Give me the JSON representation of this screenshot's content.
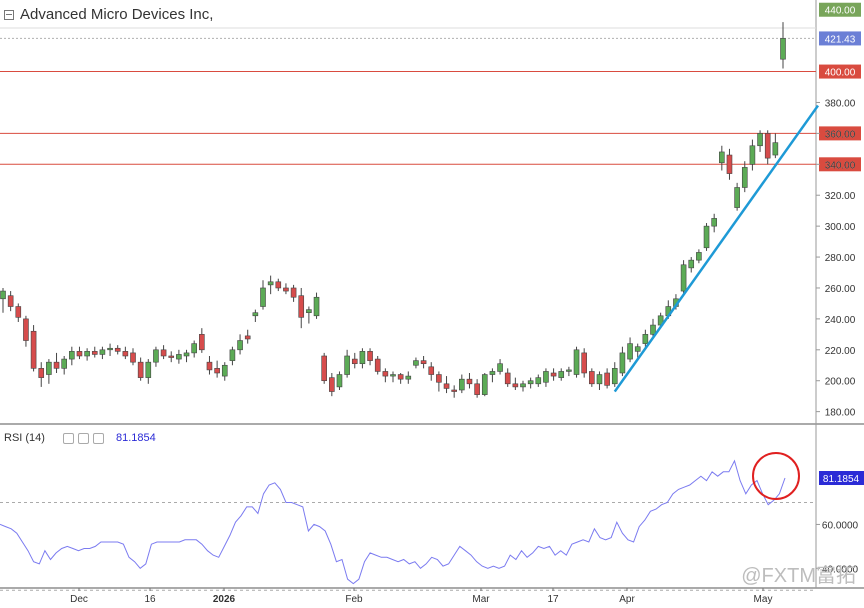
{
  "title": "Advanced Micro Devices Inc,",
  "watermark": "@FXTM富拓",
  "chart_data": [
    {
      "type": "candlestick",
      "title": "Advanced Micro Devices Inc,",
      "ylim": [
        172,
        445
      ],
      "y_ticks": [
        180,
        200,
        220,
        240,
        260,
        280,
        300,
        320,
        340,
        360,
        380
      ],
      "x_tick_labels": [
        "Dec",
        "16",
        "2026",
        "Feb",
        "Mar",
        "17",
        "Apr",
        "May"
      ],
      "up_color": "#5cab56",
      "down_color": "#d64c4c",
      "trendline_color": "#1e9ad6",
      "horizontal_lines": [
        {
          "value": 400,
          "label": "400.00",
          "color": "#d94b3f"
        },
        {
          "value": 360,
          "label": "360.00",
          "color": "#d94b3f"
        },
        {
          "value": 340,
          "label": "340.00",
          "color": "#d94b3f"
        }
      ],
      "price_labels": [
        {
          "value": 440,
          "label": "440.00",
          "color": "#78a55a"
        },
        {
          "value": 421.43,
          "label": "421.43",
          "color": "#6b7fd6"
        }
      ],
      "trendline": {
        "from": {
          "date": "Apr 1",
          "price": 193
        },
        "to": {
          "date": "May 6",
          "price": 378
        }
      },
      "candles": [
        {
          "o": 253,
          "h": 260,
          "l": 244,
          "c": 258
        },
        {
          "o": 255,
          "h": 258,
          "l": 245,
          "c": 248
        },
        {
          "o": 248,
          "h": 250,
          "l": 238,
          "c": 241
        },
        {
          "o": 240,
          "h": 242,
          "l": 222,
          "c": 226
        },
        {
          "o": 232,
          "h": 236,
          "l": 206,
          "c": 208
        },
        {
          "o": 208,
          "h": 212,
          "l": 196,
          "c": 202
        },
        {
          "o": 204,
          "h": 214,
          "l": 198,
          "c": 212
        },
        {
          "o": 212,
          "h": 218,
          "l": 205,
          "c": 208
        },
        {
          "o": 208,
          "h": 216,
          "l": 204,
          "c": 214
        },
        {
          "o": 214,
          "h": 222,
          "l": 210,
          "c": 219
        },
        {
          "o": 219,
          "h": 222,
          "l": 214,
          "c": 216
        },
        {
          "o": 216,
          "h": 221,
          "l": 213,
          "c": 219
        },
        {
          "o": 219,
          "h": 222,
          "l": 215,
          "c": 217
        },
        {
          "o": 217,
          "h": 222,
          "l": 214,
          "c": 220
        },
        {
          "o": 220,
          "h": 224,
          "l": 216,
          "c": 221
        },
        {
          "o": 221,
          "h": 223,
          "l": 217,
          "c": 219
        },
        {
          "o": 219,
          "h": 222,
          "l": 214,
          "c": 216
        },
        {
          "o": 218,
          "h": 221,
          "l": 210,
          "c": 212
        },
        {
          "o": 212,
          "h": 215,
          "l": 200,
          "c": 202
        },
        {
          "o": 202,
          "h": 214,
          "l": 198,
          "c": 212
        },
        {
          "o": 212,
          "h": 222,
          "l": 209,
          "c": 220
        },
        {
          "o": 220,
          "h": 223,
          "l": 214,
          "c": 216
        },
        {
          "o": 216,
          "h": 219,
          "l": 212,
          "c": 215
        },
        {
          "o": 214,
          "h": 220,
          "l": 211,
          "c": 217
        },
        {
          "o": 216,
          "h": 220,
          "l": 212,
          "c": 218
        },
        {
          "o": 218,
          "h": 226,
          "l": 215,
          "c": 224
        },
        {
          "o": 230,
          "h": 234,
          "l": 218,
          "c": 220
        },
        {
          "o": 212,
          "h": 216,
          "l": 204,
          "c": 207
        },
        {
          "o": 208,
          "h": 213,
          "l": 202,
          "c": 205
        },
        {
          "o": 203,
          "h": 212,
          "l": 200,
          "c": 210
        },
        {
          "o": 213,
          "h": 222,
          "l": 210,
          "c": 220
        },
        {
          "o": 220,
          "h": 230,
          "l": 217,
          "c": 226
        },
        {
          "o": 229,
          "h": 233,
          "l": 224,
          "c": 227
        },
        {
          "o": 242,
          "h": 246,
          "l": 238,
          "c": 244
        },
        {
          "o": 248,
          "h": 265,
          "l": 246,
          "c": 260
        },
        {
          "o": 262,
          "h": 268,
          "l": 256,
          "c": 264
        },
        {
          "o": 264,
          "h": 266,
          "l": 258,
          "c": 260
        },
        {
          "o": 260,
          "h": 263,
          "l": 256,
          "c": 258
        },
        {
          "o": 260,
          "h": 262,
          "l": 251,
          "c": 254
        },
        {
          "o": 255,
          "h": 260,
          "l": 234,
          "c": 241
        },
        {
          "o": 244,
          "h": 248,
          "l": 237,
          "c": 246
        },
        {
          "o": 242,
          "h": 257,
          "l": 240,
          "c": 254
        },
        {
          "o": 216,
          "h": 218,
          "l": 198,
          "c": 200
        },
        {
          "o": 202,
          "h": 205,
          "l": 190,
          "c": 193
        },
        {
          "o": 196,
          "h": 206,
          "l": 194,
          "c": 204
        },
        {
          "o": 204,
          "h": 220,
          "l": 202,
          "c": 216
        },
        {
          "o": 214,
          "h": 218,
          "l": 208,
          "c": 211
        },
        {
          "o": 211,
          "h": 221,
          "l": 208,
          "c": 219
        },
        {
          "o": 219,
          "h": 221,
          "l": 210,
          "c": 213
        },
        {
          "o": 214,
          "h": 216,
          "l": 204,
          "c": 206
        },
        {
          "o": 206,
          "h": 208,
          "l": 199,
          "c": 203
        },
        {
          "o": 203,
          "h": 206,
          "l": 199,
          "c": 204
        },
        {
          "o": 204,
          "h": 205,
          "l": 198,
          "c": 201
        },
        {
          "o": 201,
          "h": 206,
          "l": 198,
          "c": 203
        },
        {
          "o": 210,
          "h": 215,
          "l": 208,
          "c": 213
        },
        {
          "o": 213,
          "h": 216,
          "l": 208,
          "c": 211
        },
        {
          "o": 209,
          "h": 212,
          "l": 200,
          "c": 204
        },
        {
          "o": 204,
          "h": 206,
          "l": 193,
          "c": 199
        },
        {
          "o": 198,
          "h": 203,
          "l": 192,
          "c": 195
        },
        {
          "o": 194,
          "h": 197,
          "l": 189,
          "c": 193
        },
        {
          "o": 194,
          "h": 204,
          "l": 192,
          "c": 201
        },
        {
          "o": 201,
          "h": 205,
          "l": 195,
          "c": 198
        },
        {
          "o": 198,
          "h": 201,
          "l": 189,
          "c": 191
        },
        {
          "o": 191,
          "h": 205,
          "l": 190,
          "c": 204
        },
        {
          "o": 204,
          "h": 208,
          "l": 199,
          "c": 206
        },
        {
          "o": 206,
          "h": 214,
          "l": 204,
          "c": 211
        },
        {
          "o": 205,
          "h": 208,
          "l": 196,
          "c": 198
        },
        {
          "o": 198,
          "h": 202,
          "l": 194,
          "c": 196
        },
        {
          "o": 196,
          "h": 200,
          "l": 193,
          "c": 198
        },
        {
          "o": 198,
          "h": 202,
          "l": 195,
          "c": 200
        },
        {
          "o": 198,
          "h": 204,
          "l": 196,
          "c": 202
        },
        {
          "o": 199,
          "h": 208,
          "l": 196,
          "c": 206
        },
        {
          "o": 205,
          "h": 208,
          "l": 200,
          "c": 203
        },
        {
          "o": 202,
          "h": 208,
          "l": 200,
          "c": 206
        },
        {
          "o": 206,
          "h": 209,
          "l": 203,
          "c": 207
        },
        {
          "o": 204,
          "h": 222,
          "l": 202,
          "c": 220
        },
        {
          "o": 218,
          "h": 221,
          "l": 202,
          "c": 205
        },
        {
          "o": 206,
          "h": 208,
          "l": 196,
          "c": 198
        },
        {
          "o": 198,
          "h": 206,
          "l": 194,
          "c": 204
        },
        {
          "o": 205,
          "h": 208,
          "l": 195,
          "c": 197
        },
        {
          "o": 198,
          "h": 212,
          "l": 196,
          "c": 208
        },
        {
          "o": 205,
          "h": 222,
          "l": 203,
          "c": 218
        },
        {
          "o": 214,
          "h": 228,
          "l": 212,
          "c": 224
        },
        {
          "o": 219,
          "h": 224,
          "l": 215,
          "c": 222
        },
        {
          "o": 224,
          "h": 233,
          "l": 222,
          "c": 230
        },
        {
          "o": 230,
          "h": 240,
          "l": 228,
          "c": 236
        },
        {
          "o": 236,
          "h": 244,
          "l": 234,
          "c": 242
        },
        {
          "o": 242,
          "h": 252,
          "l": 240,
          "c": 248
        },
        {
          "o": 248,
          "h": 256,
          "l": 246,
          "c": 253
        },
        {
          "o": 258,
          "h": 278,
          "l": 256,
          "c": 275
        },
        {
          "o": 273,
          "h": 280,
          "l": 270,
          "c": 278
        },
        {
          "o": 278,
          "h": 285,
          "l": 276,
          "c": 283
        },
        {
          "o": 286,
          "h": 302,
          "l": 284,
          "c": 300
        },
        {
          "o": 300,
          "h": 308,
          "l": 296,
          "c": 305
        },
        {
          "o": 341,
          "h": 352,
          "l": 336,
          "c": 348
        },
        {
          "o": 346,
          "h": 350,
          "l": 330,
          "c": 334
        },
        {
          "o": 312,
          "h": 328,
          "l": 310,
          "c": 325
        },
        {
          "o": 325,
          "h": 342,
          "l": 322,
          "c": 338
        },
        {
          "o": 340,
          "h": 356,
          "l": 336,
          "c": 352
        },
        {
          "o": 352,
          "h": 362,
          "l": 348,
          "c": 360
        },
        {
          "o": 360,
          "h": 362,
          "l": 340,
          "c": 344
        },
        {
          "o": 346,
          "h": 360,
          "l": 344,
          "c": 354
        },
        {
          "o": 408,
          "h": 432,
          "l": 402,
          "c": 421.43
        }
      ]
    },
    {
      "type": "line",
      "title": "RSI (14)",
      "current_value": "81.1854",
      "current_label_color": "#2b2bd6",
      "line_color": "#7b7bf0",
      "ylim": [
        31,
        104
      ],
      "y_ticks": [
        "60.0000",
        "40.0000"
      ],
      "reference_levels": [
        70,
        30
      ],
      "values": [
        60,
        59,
        58,
        56,
        52,
        48,
        43,
        42,
        48,
        44,
        47,
        49,
        50,
        49,
        48,
        49,
        49,
        50,
        52,
        52,
        52,
        52,
        51,
        45,
        43,
        40,
        42,
        51,
        52,
        52,
        52,
        52,
        52,
        53,
        53,
        53,
        51,
        48,
        46,
        45,
        50,
        55,
        61,
        64,
        68,
        68,
        65,
        74,
        78,
        79,
        76,
        70,
        70,
        69,
        68,
        57,
        60,
        59,
        57,
        51,
        43,
        44,
        35,
        33,
        35,
        43,
        47,
        46,
        45,
        45,
        44,
        43,
        44,
        42,
        43,
        40,
        42,
        45,
        44,
        41,
        42,
        46,
        50,
        48,
        46,
        43,
        41,
        40,
        41,
        40,
        41,
        46,
        44,
        48,
        45,
        47,
        50,
        49,
        50,
        46,
        48,
        46,
        51,
        52,
        53,
        52,
        58,
        54,
        53,
        54,
        61,
        56,
        53,
        52,
        59,
        62,
        66,
        67,
        69,
        70,
        74,
        76,
        77,
        78,
        80,
        82,
        80,
        84,
        82,
        84,
        84,
        89,
        80,
        74,
        78,
        80,
        74,
        69,
        71,
        74,
        81.1854
      ]
    }
  ],
  "ui": {
    "rsi_label": "RSI (14)",
    "rsi_value": "81.1854"
  }
}
